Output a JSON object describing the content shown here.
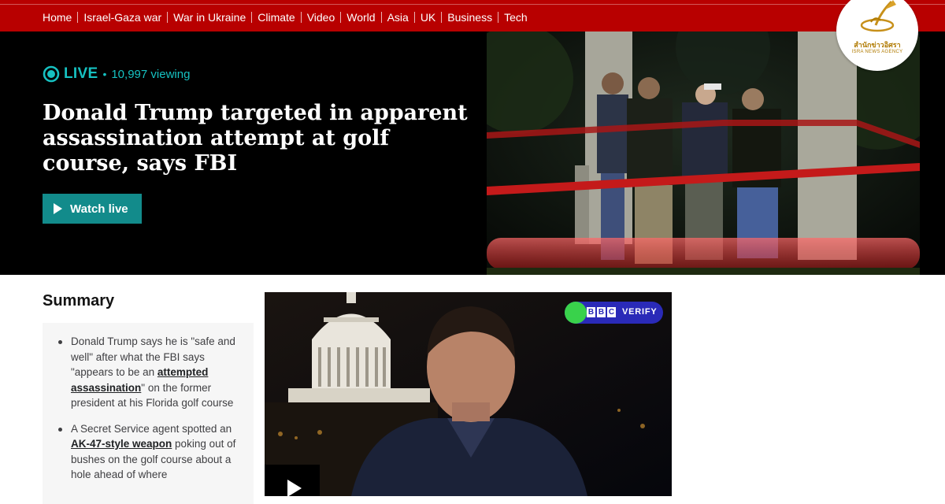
{
  "nav": {
    "items": [
      "Home",
      "Israel-Gaza war",
      "War in Ukraine",
      "Climate",
      "Video",
      "World",
      "Asia",
      "UK",
      "Business",
      "Tech"
    ]
  },
  "hero": {
    "live_label": "LIVE",
    "viewers": "10,997 viewing",
    "headline": "Donald Trump targeted in apparent assassination attempt at golf course, says FBI",
    "watch_button": "Watch live",
    "photo_icon": "crime-scene-photo"
  },
  "logo": {
    "name_thai": "สำนักข่าวอิศรา",
    "name_en": "ISRA NEWS AGENCY"
  },
  "summary": {
    "title": "Summary",
    "items": [
      {
        "pre": "Donald Trump says he is \"safe and well\" after what the FBI says \"appears to be an ",
        "link": "attempted assassination",
        "post": "\" on the former president at his Florida golf course"
      },
      {
        "pre": "A Secret Service agent spotted an ",
        "link": "AK-47-style weapon",
        "post": " poking out of bushes on the golf course about a hole ahead of where"
      }
    ]
  },
  "video": {
    "badge_letters": [
      "B",
      "B",
      "C"
    ],
    "badge_word": "VERIFY",
    "play_icon": "play-icon"
  },
  "colors": {
    "nav_red": "#b80000",
    "live_teal": "#16c1c1",
    "button_teal": "#128b8b",
    "verify_blue": "#2a2ab8",
    "verify_green": "#39d24b"
  }
}
